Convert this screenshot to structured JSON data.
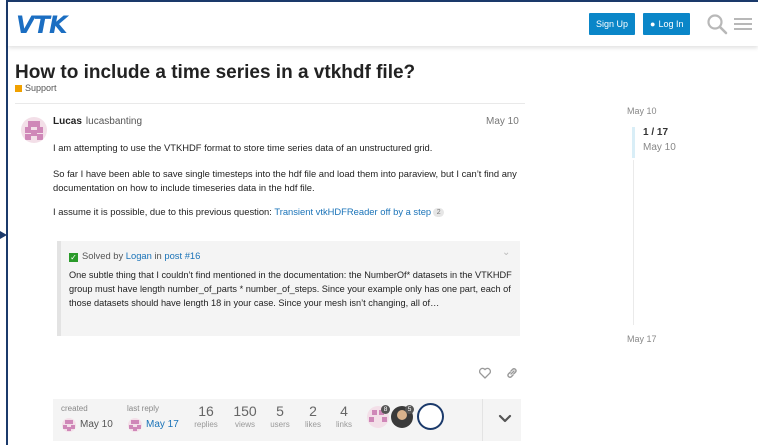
{
  "header": {
    "logo": "VTK",
    "signup_label": "Sign Up",
    "login_label": "Log In",
    "search_icon": "search-icon",
    "menu_icon": "hamburger-icon",
    "brand_color": "#0a86c8"
  },
  "topic": {
    "title": "How to include a time series in a vtkhdf file?",
    "category": "Support",
    "category_color": "#f1a100"
  },
  "post": {
    "author_name": "Lucas",
    "author_username": "lucasbanting",
    "date": "May 10",
    "para1": "I am attempting to use the VTKHDF format to store time series data of an unstructured grid.",
    "para2": "So far I have been able to save single timesteps into the hdf file and load them into paraview, but I can’t find any documentation on how to include timeseries data in the hdf file.",
    "para3_prefix": "I assume it is possible, due to this previous question: ",
    "para3_link": "Transient vtkHDFReader off by a step",
    "para3_link_count": "2",
    "solution": {
      "prefix": "Solved by ",
      "solver": "Logan",
      "in": " in ",
      "post_link": "post #16",
      "excerpt": "One subtle thing that I couldn’t find mentioned in the documentation: the NumberOf* datasets in the VTKHDF group must have length number_of_parts * number_of_steps. Since your example only has one part, each of those datasets should have length 18 in your case. Since your mesh isn’t changing, all of…"
    }
  },
  "timeline": {
    "top_date": "May 10",
    "position": "1 / 17",
    "position_date": "May 10",
    "bottom_date": "May 17"
  },
  "topic_map": {
    "created_label": "created",
    "created_date": "May 10",
    "last_reply_label": "last reply",
    "last_reply_date": "May 17",
    "stats": [
      {
        "value": "16",
        "label": "replies"
      },
      {
        "value": "150",
        "label": "views"
      },
      {
        "value": "5",
        "label": "users"
      },
      {
        "value": "2",
        "label": "likes"
      },
      {
        "value": "4",
        "label": "links"
      }
    ],
    "participant_counts": [
      "8",
      "5"
    ]
  }
}
